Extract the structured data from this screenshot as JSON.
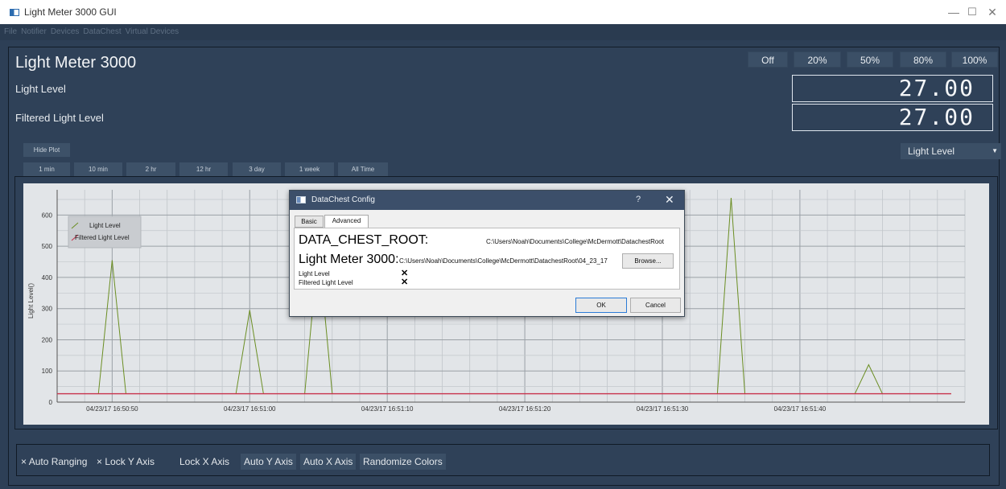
{
  "window": {
    "title": "Light Meter 3000 GUI",
    "minimize_icon": "minimize-icon",
    "maximize_icon": "maximize-icon",
    "close_icon": "close-icon"
  },
  "menu": [
    "File",
    "Notifier",
    "Devices",
    "DataChest",
    "Virtual Devices"
  ],
  "device": {
    "title": "Light Meter 3000",
    "presets": [
      "Off",
      "20%",
      "50%",
      "80%",
      "100%"
    ],
    "readings": [
      {
        "label": "Light Level",
        "value": "27.00"
      },
      {
        "label": "Filtered Light Level",
        "value": "27.00"
      }
    ],
    "hide_plot": "Hide Plot",
    "time_ranges": [
      "1 min",
      "10 min",
      "2 hr",
      "12 hr",
      "3 day",
      "1 week",
      "All Time"
    ],
    "plot_select": {
      "value": "Light Level",
      "arrow_icon": "dropdown-arrow-icon"
    }
  },
  "chart_data": {
    "type": "line",
    "ylabel": "Light Level()",
    "ylim": [
      0,
      650
    ],
    "yticks": [
      0,
      100,
      200,
      300,
      400,
      500,
      600
    ],
    "x_tick_labels": [
      "04/23/17 16:50:50",
      "04/23/17 16:51:00",
      "04/23/17 16:51:10",
      "04/23/17 16:51:20",
      "04/23/17 16:51:30",
      "04/23/17 16:51:40"
    ],
    "x_tick_seconds": [
      50,
      60,
      70,
      80,
      90,
      100
    ],
    "xlim": [
      46,
      112
    ],
    "grid": true,
    "legend_position": "top-left",
    "series": [
      {
        "name": "Light Level",
        "color": "#6b8e23",
        "x": [
          46,
          49,
          50,
          51,
          59,
          60,
          61,
          62,
          64,
          65,
          66,
          94,
          95,
          96,
          97,
          104,
          105,
          106,
          111
        ],
        "values": [
          27,
          27,
          455,
          27,
          27,
          295,
          27,
          27,
          27,
          500,
          27,
          27,
          655,
          27,
          27,
          27,
          120,
          27,
          27
        ]
      },
      {
        "name": "Filtered Light Level",
        "color": "#c8304a",
        "x": [
          46,
          111
        ],
        "values": [
          27,
          27
        ]
      }
    ]
  },
  "controls": {
    "auto_ranging": "Auto Ranging",
    "lock_y": "Lock Y Axis",
    "lock_x": "Lock X Axis",
    "auto_y": "Auto Y Axis",
    "auto_x": "Auto X Axis",
    "randomize": "Randomize Colors",
    "check_mark": "×"
  },
  "dialog": {
    "title": "DataChest Config",
    "help": "?",
    "close": "✕",
    "tabs": [
      "Basic",
      "Advanced"
    ],
    "root_label": "DATA_CHEST_ROOT:",
    "root_path": "C:\\Users\\Noah\\Documents\\College\\McDermott\\DatachestRoot",
    "device_label": "Light Meter 3000:",
    "device_path": "C:\\Users\\Noah\\Documents\\College\\McDermott\\DatachestRoot\\04_23_17",
    "browse": "Browse...",
    "items": [
      {
        "label": "Light Level",
        "mark": "✕"
      },
      {
        "label": "Filtered Light Level",
        "mark": "✕"
      }
    ],
    "ok": "OK",
    "cancel": "Cancel"
  }
}
